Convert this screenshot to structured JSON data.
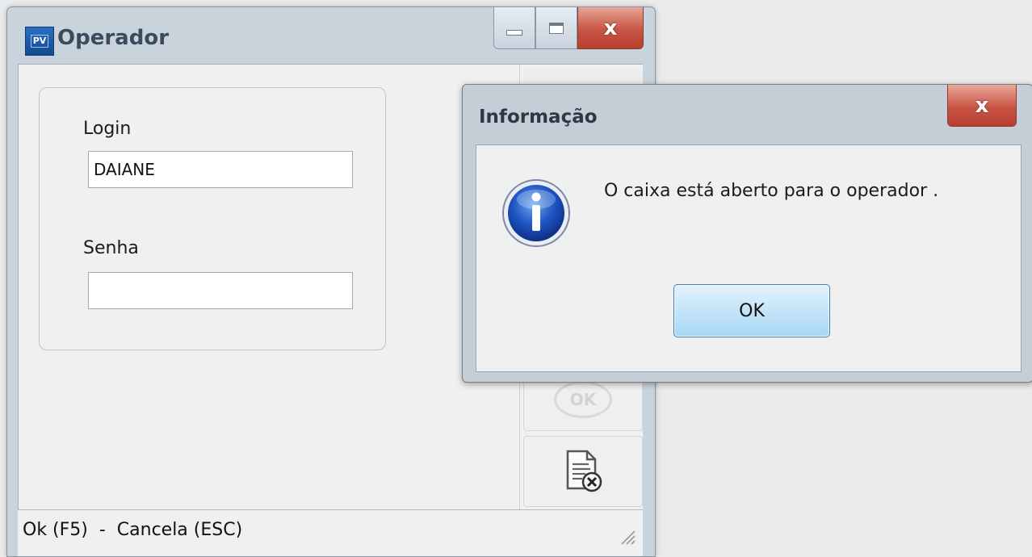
{
  "main_window": {
    "title": "Operador",
    "app_icon_text": "PV",
    "caption_buttons": {
      "minimize_icon": "minimize-icon",
      "maximize_icon": "maximize-icon",
      "close_icon": "close-icon",
      "close_glyph": "x"
    },
    "form": {
      "login_label": "Login",
      "login_value": "DAIANE",
      "password_label": "Senha",
      "password_value": ""
    },
    "side_buttons": {
      "ok_icon": "ok-circle-icon",
      "ok_glyph_text": "OK",
      "cancel_icon": "document-cancel-icon"
    },
    "status_bar": {
      "text": "Ok (F5)  -  Cancela (ESC)"
    }
  },
  "dialog": {
    "title": "Informação",
    "close_glyph": "x",
    "icon": "info-icon",
    "message": "O caixa está aberto para o operador .",
    "ok_label": "OK"
  },
  "colors": {
    "window_frame": "#c9d3dc",
    "close_red": "#c75444",
    "ok_button_blue": "#c4e4f8",
    "info_icon_blue": "#1f56c4"
  }
}
